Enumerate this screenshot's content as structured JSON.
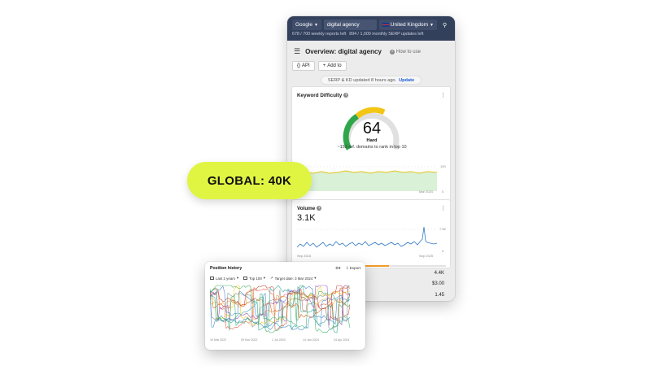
{
  "search": {
    "engine": "Google",
    "query": "digital agency",
    "country": "United Kingdom",
    "quota_reports": "678 / 700 weekly reports left",
    "quota_serp": "894 / 1,000 monthly SERP updates left"
  },
  "overview": {
    "title": "Overview: digital agency",
    "how_to_use": "How to use",
    "api_label": "API",
    "add_to_label": "Add to",
    "updated_text": "SERP & KD updated 8 hours ago.",
    "update_link": "Update"
  },
  "keyword_difficulty": {
    "title": "Keyword Difficulty",
    "value": "64",
    "level": "Hard",
    "description": "~153 ref. domains to rank in top 10",
    "axis_top": "100",
    "axis_bottom": "0",
    "date_label": "Mar 2024",
    "colors": {
      "green": "#2fa64a",
      "yellow": "#f3c515",
      "grey": "#e0e0e0"
    }
  },
  "volume": {
    "title": "Volume",
    "value": "3.1K",
    "axis_top": "7.5K",
    "axis_bottom": "0",
    "date_start": "Sep 2015",
    "date_end": "Sep 2025"
  },
  "metrics": {
    "m1": "4.4K",
    "m2": "$3.00",
    "m3": "1.45"
  },
  "badge": {
    "text": "GLOBAL: 40K"
  },
  "position_history": {
    "title": "Position history",
    "export_label": "Export",
    "filter_period": "Last 2 years",
    "filter_top": "Top 100",
    "filter_target": "Target date: 3 Mar 2024",
    "x_labels": [
      "19 Mar 2022",
      "29 Nov 2022",
      "1 Jul 2023",
      "14 Jan 2024",
      "24 Apr 2024"
    ]
  }
}
